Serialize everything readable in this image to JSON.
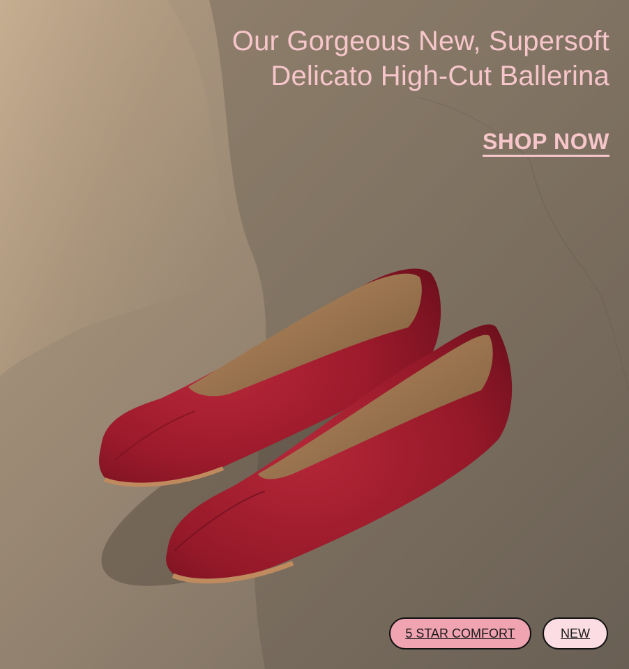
{
  "hero": {
    "headline_line1": "Our Gorgeous New, Supersoft",
    "headline_line2": "Delicato High-Cut Ballerina",
    "cta_label": "SHOP NOW"
  },
  "badges": {
    "comfort_label": "5 STAR COMFORT",
    "new_label": "NEW"
  },
  "colors": {
    "text_pink": "#f6c6cb",
    "badge_comfort_bg": "#f0a3b0",
    "badge_new_bg": "#fbdde3",
    "shoe_red": "#9e1c2c"
  }
}
